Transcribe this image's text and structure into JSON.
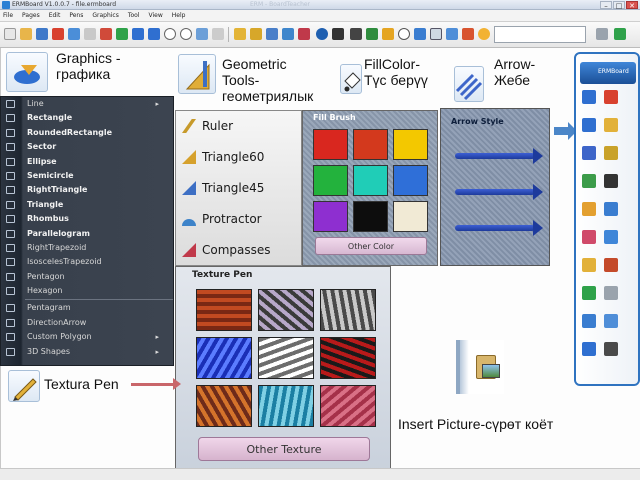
{
  "window": {
    "title": "ERMBoard V1.0.0.7 - file.ermboard",
    "faded_text": "ERM - BoardTeacher",
    "buttons": [
      "–",
      "□",
      "✕"
    ]
  },
  "menubar": [
    "File",
    "Pages",
    "Edit",
    "Pens",
    "Graphics",
    "Tool",
    "View",
    "Help"
  ],
  "labels": {
    "graphics": "Graphics -\nграфика",
    "geometric": "Geometric\nTools-\nгеометриялык",
    "fillcolor": "FillColor-\nТүс берүү",
    "arrow": "Arrow-\nЖебе",
    "textura": "Textura Pen",
    "insert_picture": "Insert Picture-сүрөт коёт"
  },
  "graphics_menu": {
    "items": [
      {
        "label": "Line",
        "submenu": true,
        "thin": true
      },
      {
        "label": "Rectangle"
      },
      {
        "label": "RoundedRectangle"
      },
      {
        "label": "Sector"
      },
      {
        "label": "Ellipse"
      },
      {
        "label": "Semicircle"
      },
      {
        "label": "RightTriangle"
      },
      {
        "label": "Triangle"
      },
      {
        "label": "Rhombus"
      },
      {
        "label": "Parallelogram"
      },
      {
        "label": "RightTrapezoid",
        "thin": true
      },
      {
        "label": "IsoscelesTrapezoid",
        "thin": true
      },
      {
        "label": "Pentagon",
        "thin": true
      },
      {
        "label": "Hexagon",
        "thin": true
      },
      {
        "label": "Pentagram",
        "thin": true,
        "sep_before": true
      },
      {
        "label": "DirectionArrow",
        "thin": true
      },
      {
        "label": "Custom Polygon",
        "submenu": true,
        "thin": true
      },
      {
        "label": "3D Shapes",
        "submenu": true,
        "thin": true
      }
    ]
  },
  "geometric_menu": {
    "items": [
      {
        "label": "Ruler",
        "icon": "ruler-icon",
        "color": "#c79a2a"
      },
      {
        "label": "Triangle60",
        "icon": "triangle-60-icon",
        "color": "#d6a12c"
      },
      {
        "label": "Triangle45",
        "icon": "triangle-45-icon",
        "color": "#3d6fc4"
      },
      {
        "label": "Protractor",
        "icon": "protractor-icon",
        "color": "#3d83c9"
      },
      {
        "label": "Compasses",
        "icon": "compasses-icon",
        "color": "#c0394a"
      }
    ]
  },
  "fill_panel": {
    "title": "Fill Brush",
    "colors": [
      "#d9271f",
      "#d3391d",
      "#f3c800",
      "#23b23d",
      "#20cdb7",
      "#2f6fd8",
      "#8e2fd0",
      "#0d0d0d",
      "#f1ead5"
    ],
    "other_label": "Other Color"
  },
  "arrow_panel": {
    "title": "Arrow Style",
    "count": 3
  },
  "texture_panel": {
    "title": "Texture Pen",
    "tiles": [
      [
        "#7a2814",
        "#c24a21"
      ],
      [
        "#3a3a3a",
        "#b7a7c9"
      ],
      [
        "#4a4a4a",
        "#c9c9c9"
      ],
      [
        "#1a2fb7",
        "#5b7cff"
      ],
      [
        "#6d6d6d",
        "#ffffff"
      ],
      [
        "#b81a1a",
        "#1a1a1a"
      ],
      [
        "#6e2b1a",
        "#d4732b"
      ],
      [
        "#1b7fa3",
        "#7fd0e4"
      ],
      [
        "#a53149",
        "#d97086"
      ]
    ],
    "other_label": "Other Texture"
  },
  "right_toolbar": {
    "brand": "ERMBoard"
  }
}
